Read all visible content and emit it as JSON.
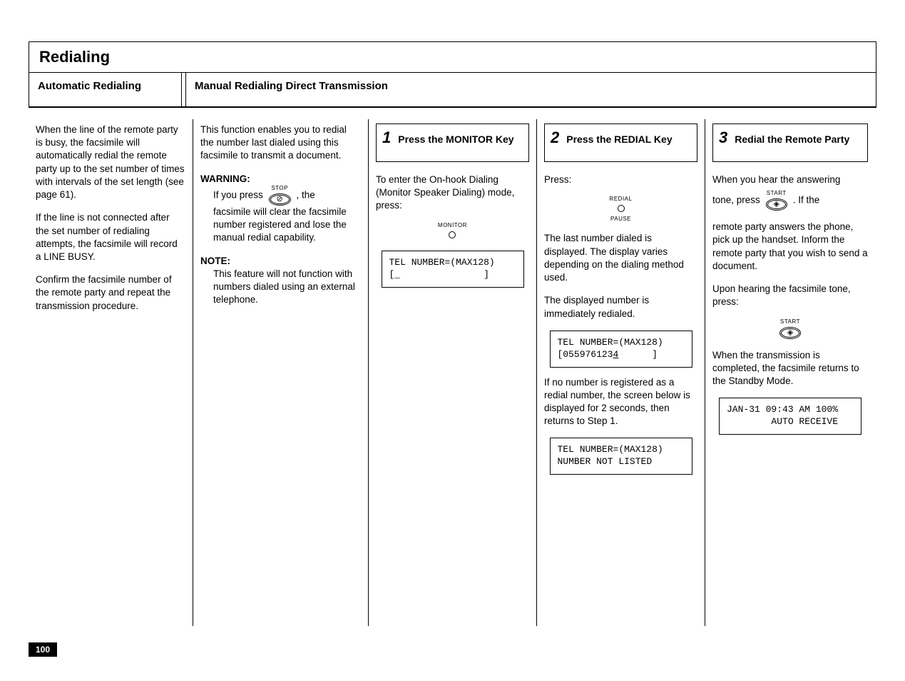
{
  "page": {
    "number": "100",
    "title": "Redialing",
    "sections": {
      "auto": {
        "title": "Automatic Redialing"
      },
      "manual": {
        "title": "Manual Redialing Direct Transmission"
      }
    }
  },
  "col1": {
    "p1": "When the line of the remote party is busy, the facsimile will automatically redial the remote party up to the set number of times with intervals of the set length (see page 61).",
    "p2": "If the line is not connected after the set number of redialing attempts, the facsimile will record a LINE BUSY.",
    "p3": "Confirm the facsimile number of the remote party and repeat the transmission procedure."
  },
  "col2": {
    "p1": "This function enables you to redial the number last dialed using this facsimile to transmit a document.",
    "warn_label": "WARNING:",
    "warn_pre": "If you press ",
    "warn_post": ", the",
    "warn_body": "facsimile will clear the facsimile number registered and lose the manual redial capability.",
    "note_label": "NOTE:",
    "note_body": "This feature will not function with numbers dialed using an external telephone.",
    "stop_key": {
      "top": "STOP",
      "glyph": "⊘"
    }
  },
  "col3": {
    "step_num": "1",
    "step_title": "Press the MONITOR Key",
    "p1": "To enter the On-hook Dialing (Monitor Speaker Dialing) mode, press:",
    "monitor_key": {
      "top": "MONITOR"
    },
    "lcd1_l1": "TEL NUMBER=(MAX128)",
    "lcd1_l2": "[_               ]"
  },
  "col4": {
    "step_num": "2",
    "step_title": "Press the REDIAL Key",
    "p1": "Press:",
    "redial_key": {
      "top": "REDIAL",
      "bottom": "PAUSE"
    },
    "p2": "The last number dialed is displayed. The display varies depending on the dialing method used.",
    "p3": "The displayed number is immediately redialed.",
    "lcd1_l1": "TEL NUMBER=(MAX128)",
    "lcd1_l2_pre": "[055976123",
    "lcd1_l2_cursor": "4",
    "lcd1_l2_post": "      ]",
    "p4": "If no number is registered as a redial number, the screen below is displayed for 2 seconds, then returns to Step 1.",
    "lcd2_l1": "TEL NUMBER=(MAX128)",
    "lcd2_l2": "NUMBER NOT LISTED"
  },
  "col5": {
    "step_num": "3",
    "step_title": "Redial the Remote Party",
    "p1_pre": "When you hear the answering",
    "p1_mid_a": "tone, press ",
    "p1_mid_b": ".   If the",
    "p2": "remote party answers the phone, pick up the handset. Inform the remote party that you wish to send a document.",
    "p3": "Upon hearing the facsimile tone, press:",
    "start_key": {
      "top": "START",
      "glyph": "◈"
    },
    "p4": "When the transmission is completed, the facsimile returns to the Standby Mode.",
    "lcd_l1": "JAN-31 09:43 AM 100%",
    "lcd_l2": "        AUTO RECEIVE"
  }
}
